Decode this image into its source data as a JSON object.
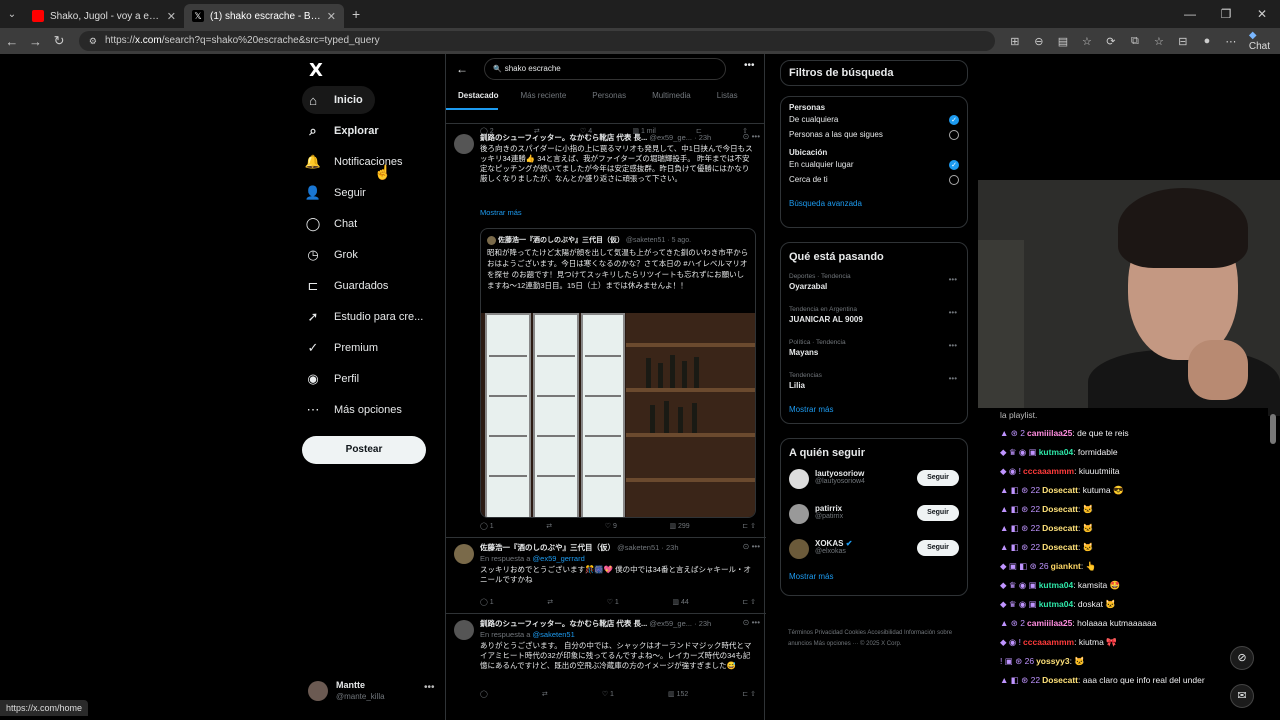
{
  "browser": {
    "tabs": [
      {
        "title": "Shako, Jugol - voy a explotar el bus",
        "active": false
      },
      {
        "title": "(1) shako escrache - Buscar / X",
        "active": true
      }
    ],
    "url_prefix": "https://",
    "url_host": "x.com",
    "url_rest": "/search?q=shako%20escrache&src=typed_query",
    "chat_label": "Chat",
    "status_url": "https://x.com/home"
  },
  "sidebar": {
    "logo": "X",
    "items": [
      {
        "label": "Inicio",
        "icon": "⌂"
      },
      {
        "label": "Explorar",
        "icon": "⌕"
      },
      {
        "label": "Notificaciones",
        "icon": "🔔"
      },
      {
        "label": "Seguir",
        "icon": "👤"
      },
      {
        "label": "Chat",
        "icon": "◯"
      },
      {
        "label": "Grok",
        "icon": "◷"
      },
      {
        "label": "Guardados",
        "icon": "⊏"
      },
      {
        "label": "Estudio para cre...",
        "icon": "➚"
      },
      {
        "label": "Premium",
        "icon": "✓"
      },
      {
        "label": "Perfil",
        "icon": "◉"
      },
      {
        "label": "Más opciones",
        "icon": "⋯"
      }
    ],
    "post_label": "Postear",
    "profile": {
      "name": "Mantte",
      "handle": "@mante_killa"
    }
  },
  "search": {
    "query": "shako escrache",
    "tabs": [
      "Destacado",
      "Más reciente",
      "Personas",
      "Multimedia",
      "Listas"
    ]
  },
  "top_stats": {
    "replies": "2",
    "retweets": "",
    "likes": "4",
    "views": "1 mil"
  },
  "tweets": [
    {
      "name": "釧路のシューフィッター。なかむら靴店 代表 長...",
      "handle": "@ex59_ge...",
      "time": "23h",
      "text": "後ろ向きのスパイダーに小指の上に罠るマリオも発見して、中1日挟んで今日もスッキリ34連勝👍 34と言えば、我がファイターズの堀瑞輝投手。 昨年までは不安定なピッチングが続いてましたが今年は安定感抜群。昨日負けて優勝にはかなり厳しくなりましたが、なんとか盛り返さに頑張って下さい。",
      "show_more": "Mostrar más",
      "quote": {
        "name": "佐藤浩一『酒のしのぶや』三代目（仮）",
        "handle": "@saketen51",
        "time": "5 ago.",
        "text": "昭和が降ってたけど太陽が顔を出して気温も上がってきた釧のいわき市平からおはようございます。今日は寒くなるのかな？さて本日の #ハイレベルマリオを探せ のお題です！見つけてスッキリしたらリツイートも忘れずにお願いしますね〜12連勤3日目。15日（土）までは休みませんよ！！"
      },
      "stats": {
        "replies": "1",
        "retweets": "",
        "likes": "9",
        "views": "299"
      }
    },
    {
      "name": "佐藤浩一『酒のしのぶや』三代目（仮）",
      "handle": "@saketen51",
      "time": "23h",
      "reply_prefix": "En respuesta a",
      "reply_to": "@ex59_gerrard",
      "text": "スッキリおめでとうございます🎊🎆💖 僕の中では34番と言えばシャキール・オニールですかね",
      "stats": {
        "replies": "1",
        "retweets": "",
        "likes": "1",
        "views": "44"
      }
    },
    {
      "name": "釧路のシューフィッター。なかむら靴店 代表 長...",
      "handle": "@ex59_ge...",
      "time": "23h",
      "reply_prefix": "En respuesta a",
      "reply_to": "@saketen51",
      "text": "ありがとうございます。 自分の中では、シャックはオーランドマジック時代とマイアミヒート時代の32が印象に残ってるんですよね〜。レイカーズ時代の34も記憶にあるんですけど、既出の空飛ぶ冷蔵庫の方のイメージが強すぎました😅",
      "stats": {
        "replies": "",
        "retweets": "",
        "likes": "1",
        "views": "152"
      }
    }
  ],
  "filters": {
    "title": "Filtros de búsqueda",
    "people_label": "Personas",
    "people_opts": [
      "De cualquiera",
      "Personas a las que sigues"
    ],
    "location_label": "Ubicación",
    "location_opts": [
      "En cualquier lugar",
      "Cerca de ti"
    ],
    "advanced": "Búsqueda avanzada"
  },
  "trends": {
    "title": "Qué está pasando",
    "items": [
      {
        "context": "Deportes · Tendencia",
        "topic": "Oyarzabal"
      },
      {
        "context": "Tendencia en Argentina",
        "topic": "JUANICAR AL 9009"
      },
      {
        "context": "Política · Tendencia",
        "topic": "Mayans"
      },
      {
        "context": "Tendencias",
        "topic": "Lilia"
      }
    ],
    "more": "Mostrar más"
  },
  "who_to_follow": {
    "title": "A quién seguir",
    "button": "Seguir",
    "items": [
      {
        "name": "lautyosoriow",
        "handle": "@lautyosoriow4"
      },
      {
        "name": "patirrix",
        "handle": "@patirrix"
      },
      {
        "name": "XOKAS",
        "handle": "@elxokas"
      }
    ],
    "more": "Mostrar más"
  },
  "footer": "Términos   Privacidad   Cookies   Accesibilidad   Información sobre anuncios   Más opciones ···   © 2025 X Corp.",
  "stream_chat": {
    "top_fragment": "la playlist.",
    "lines": [
      {
        "badges": "▲ ⊛ 2",
        "user": "camiiilaa25",
        "color": "#ff8de0",
        "msg": ": de que te reis"
      },
      {
        "badges": "◆ ♛ ◉ ▣",
        "user": "kutma04",
        "color": "#2ee6a8",
        "msg": ": formidable"
      },
      {
        "badges": "◆ ◉ !",
        "user": "cccaaammm",
        "color": "#ff3b3b",
        "msg": ": kiuuutmiita"
      },
      {
        "badges": "▲ ◧ ⊛ 22",
        "user": "Dosecatt",
        "color": "#ffe27a",
        "msg": ": kutuma 😎"
      },
      {
        "badges": "▲ ◧ ⊛ 22",
        "user": "Dosecatt",
        "color": "#ffe27a",
        "msg": ": 🐱"
      },
      {
        "badges": "▲ ◧ ⊛ 22",
        "user": "Dosecatt",
        "color": "#ffe27a",
        "msg": ": 🐱"
      },
      {
        "badges": "▲ ◧ ⊛ 22",
        "user": "Dosecatt",
        "color": "#ffe27a",
        "msg": ": 🐱"
      },
      {
        "badges": "◆ ▣ ◧ ⊛ 26",
        "user": "gianknt",
        "color": "#ffd866",
        "msg": ": 👆"
      },
      {
        "badges": "◆ ♛ ◉ ▣",
        "user": "kutma04",
        "color": "#2ee6a8",
        "msg": ": kamsita 🤩"
      },
      {
        "badges": "◆ ♛ ◉ ▣",
        "user": "kutma04",
        "color": "#2ee6a8",
        "msg": ": doskat 🐱"
      },
      {
        "badges": "▲ ⊛ 2",
        "user": "camiiilaa25",
        "color": "#ff8de0",
        "msg": ": holaaaa kutmaaaaaa"
      },
      {
        "badges": "◆ ◉ !",
        "user": "cccaaammm",
        "color": "#ff3b3b",
        "msg": ": kiutma 🎀"
      },
      {
        "badges": "! ▣ ⊛ 26",
        "user": "yossyy3",
        "color": "#ffe27a",
        "msg": ": 🐱"
      },
      {
        "badges": "▲ ◧ ⊛ 22",
        "user": "Dosecatt",
        "color": "#ffe27a",
        "msg": ": aaa claro que info real del under"
      }
    ]
  },
  "colors": {
    "accent": "#1d9bf0",
    "bg": "#000000",
    "border": "#2f3336"
  }
}
